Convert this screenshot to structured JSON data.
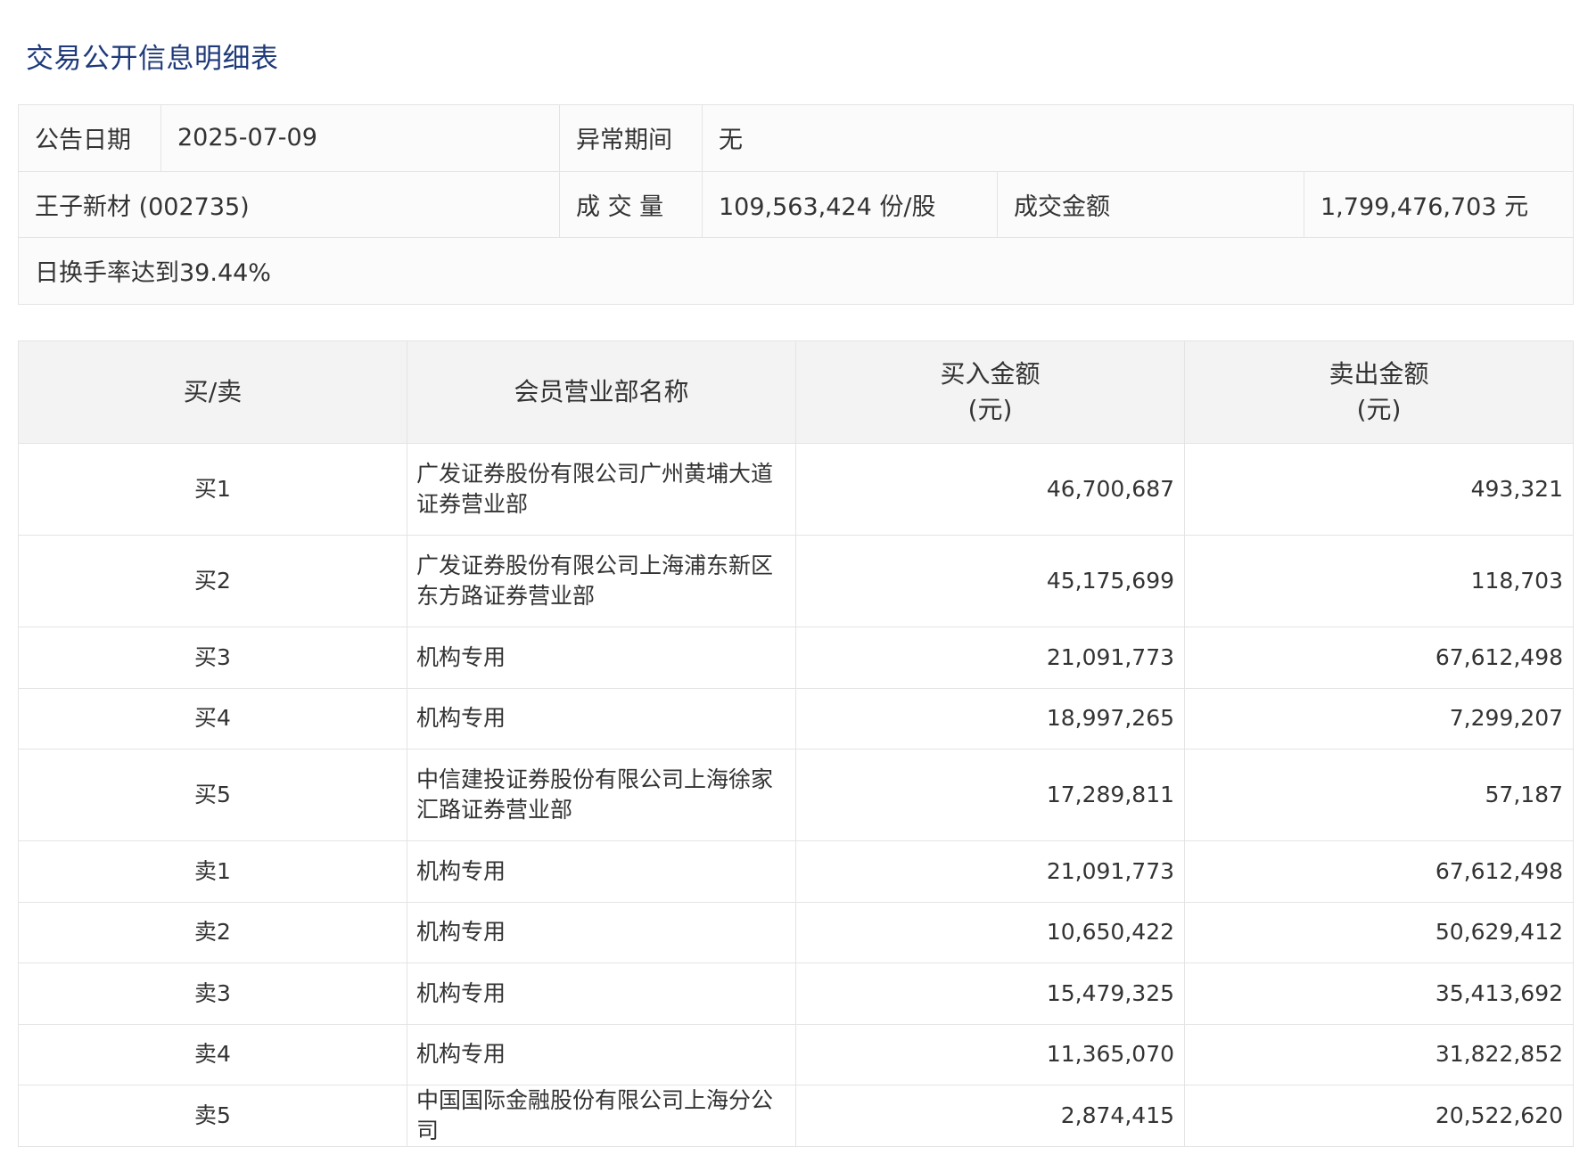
{
  "title": "交易公开信息明细表",
  "info": {
    "announce_date_label": "公告日期",
    "announce_date_value": "2025-07-09",
    "abnormal_period_label": "异常期间",
    "abnormal_period_value": "无",
    "stock_name": "王子新材 (002735)",
    "volume_label": "成 交 量",
    "volume_value": "109,563,424 份/股",
    "amount_label": "成交金额",
    "amount_value": "1,799,476,703 元",
    "reason": "日换手率达到39.44%"
  },
  "table": {
    "headers": {
      "side": "买/卖",
      "member": "会员营业部名称",
      "buy_line1": "买入金额",
      "buy_line2": "(元)",
      "sell_line1": "卖出金额",
      "sell_line2": "(元)"
    },
    "rows": [
      {
        "side": "买1",
        "name": "广发证券股份有限公司广州黄埔大道证券营业部",
        "buy": "46,700,687",
        "sell": "493,321"
      },
      {
        "side": "买2",
        "name": "广发证券股份有限公司上海浦东新区东方路证券营业部",
        "buy": "45,175,699",
        "sell": "118,703"
      },
      {
        "side": "买3",
        "name": "机构专用",
        "buy": "21,091,773",
        "sell": "67,612,498"
      },
      {
        "side": "买4",
        "name": "机构专用",
        "buy": "18,997,265",
        "sell": "7,299,207"
      },
      {
        "side": "买5",
        "name": "中信建投证券股份有限公司上海徐家汇路证券营业部",
        "buy": "17,289,811",
        "sell": "57,187"
      },
      {
        "side": "卖1",
        "name": "机构专用",
        "buy": "21,091,773",
        "sell": "67,612,498"
      },
      {
        "side": "卖2",
        "name": "机构专用",
        "buy": "10,650,422",
        "sell": "50,629,412"
      },
      {
        "side": "卖3",
        "name": "机构专用",
        "buy": "15,479,325",
        "sell": "35,413,692"
      },
      {
        "side": "卖4",
        "name": "机构专用",
        "buy": "11,365,070",
        "sell": "31,822,852"
      },
      {
        "side": "卖5",
        "name": "中国国际金融股份有限公司上海分公司",
        "buy": "2,874,415",
        "sell": "20,522,620"
      }
    ]
  }
}
